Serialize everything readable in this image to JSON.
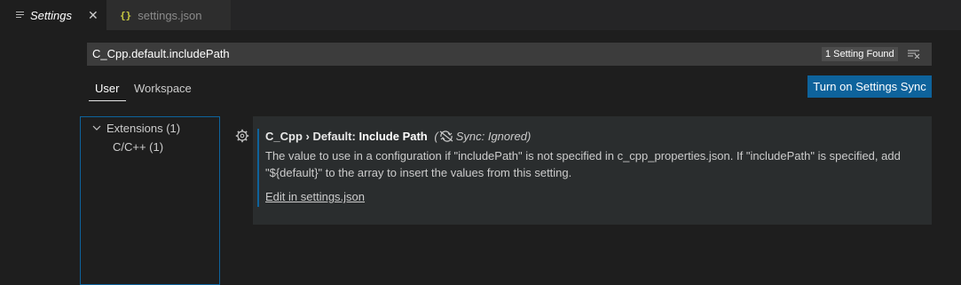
{
  "tabs": [
    {
      "label": "Settings",
      "icon": "preview-lines-icon",
      "active": true
    },
    {
      "label": "settings.json",
      "icon": "json-braces-icon",
      "active": false
    }
  ],
  "search": {
    "value": "C_Cpp.default.includePath",
    "result_count": "1 Setting Found"
  },
  "scopes": {
    "user": "User",
    "workspace": "Workspace",
    "selected": "User"
  },
  "sync_button": "Turn on Settings Sync",
  "toc": {
    "group": "Extensions (1)",
    "item": "C/C++ (1)"
  },
  "setting": {
    "category": "C_Cpp › Default: ",
    "label": "Include Path",
    "sync_status": "Sync: Ignored",
    "description": "The value to use in a configuration if \"includePath\" is not specified in c_cpp_properties.json. If \"includePath\" is specified, add \"${default}\" to the array to insert the values from this setting.",
    "edit_link": "Edit in settings.json"
  },
  "colors": {
    "accent": "#0e639c",
    "background": "#1e1e1e",
    "card": "#2a2d2e"
  }
}
